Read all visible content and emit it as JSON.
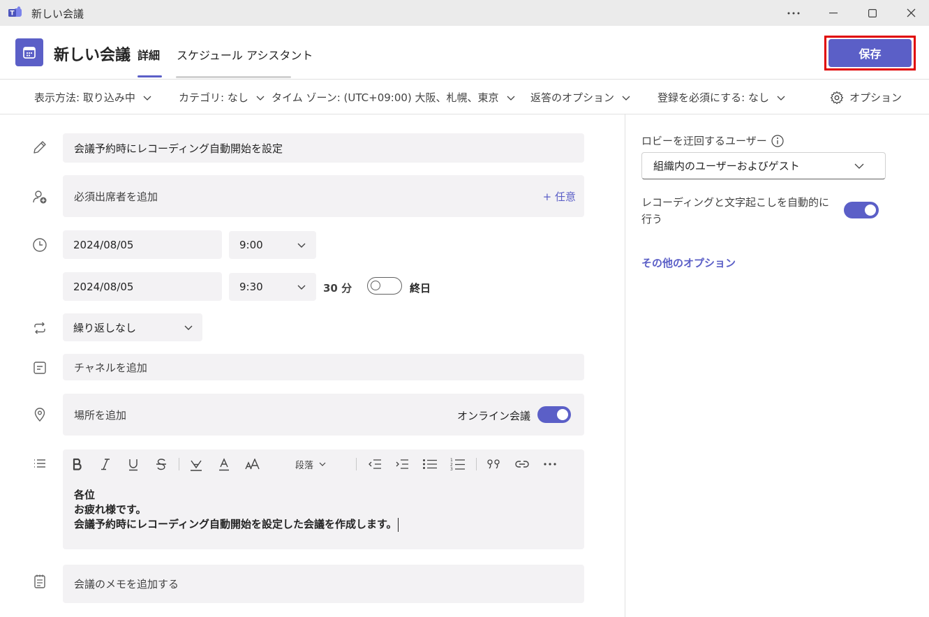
{
  "window": {
    "title": "新しい会議"
  },
  "header": {
    "title": "新しい会議",
    "tabs": [
      {
        "label": "詳細",
        "active": true
      },
      {
        "label": "スケジュール アシスタント",
        "active": false
      }
    ],
    "save_label": "保存"
  },
  "options_bar": {
    "show_as": "表示方法: 取り込み中",
    "category": "カテゴリ: なし",
    "timezone": "タイム ゾーン: (UTC+09:00) 大阪、札幌、東京",
    "response": "返答のオプション",
    "registration": "登録を必須にする: なし",
    "options": "オプション"
  },
  "form": {
    "title_value": "会議予約時にレコーディング自動開始を設定",
    "attendees_placeholder": "必須出席者を追加",
    "optional_link": "+ 任意",
    "start_date": "2024/08/05",
    "start_time": "9:00",
    "end_date": "2024/08/05",
    "end_time": "9:30",
    "duration": "30 分",
    "all_day_label": "終日",
    "all_day_on": false,
    "repeat": "繰り返しなし",
    "channel_placeholder": "チャネルを追加",
    "location_placeholder": "場所を追加",
    "online_label": "オンライン会議",
    "online_on": true,
    "editor": {
      "paragraph_label": "段落",
      "lines": [
        "各位",
        "お疲れ様です。",
        "会議予約時にレコーディング自動開始を設定した会議を作成します。"
      ]
    },
    "notes_placeholder": "会議のメモを追加する"
  },
  "right_panel": {
    "lobby_label": "ロビーを迂回するユーザー",
    "lobby_value": "組織内のユーザーおよびゲスト",
    "auto_record_label": "レコーディングと文字起こしを自動的に行う",
    "auto_record_on": true,
    "more_options": "その他のオプション"
  },
  "colors": {
    "accent": "#5b5fc7",
    "highlight_border": "#e00000",
    "field_bg": "#f3f2f4"
  }
}
